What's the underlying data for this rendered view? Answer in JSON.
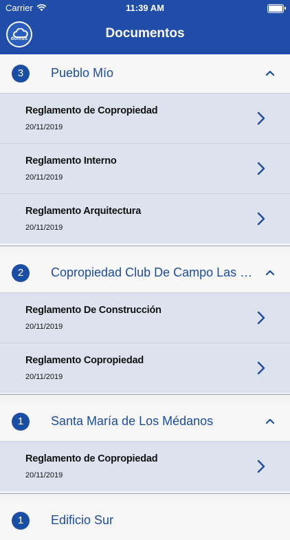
{
  "status_bar": {
    "carrier": "Carrier",
    "time": "11:39 AM"
  },
  "header": {
    "logo_text": "domus",
    "title": "Documentos"
  },
  "colors": {
    "header_bg": "#1f4da8",
    "accent": "#1a4da4",
    "row_bg": "#dde3ee"
  },
  "sections": [
    {
      "badge": "3",
      "title": "Pueblo Mío",
      "docs": [
        {
          "name": "Reglamento de Copropiedad",
          "date": "20/11/2019"
        },
        {
          "name": "Reglamento Interno",
          "date": "20/11/2019"
        },
        {
          "name": "Reglamento Arquitectura",
          "date": "20/11/2019"
        }
      ]
    },
    {
      "badge": "2",
      "title": "Copropiedad Club De Campo Las Brisas",
      "docs": [
        {
          "name": "Reglamento De Construcción",
          "date": "20/11/2019"
        },
        {
          "name": "Reglamento Copropiedad",
          "date": "20/11/2019"
        }
      ]
    },
    {
      "badge": "1",
      "title": "Santa María de Los Médanos",
      "docs": [
        {
          "name": "Reglamento de Copropiedad",
          "date": "20/11/2019"
        }
      ]
    },
    {
      "badge": "1",
      "title": "Edificio Sur",
      "docs": []
    }
  ]
}
